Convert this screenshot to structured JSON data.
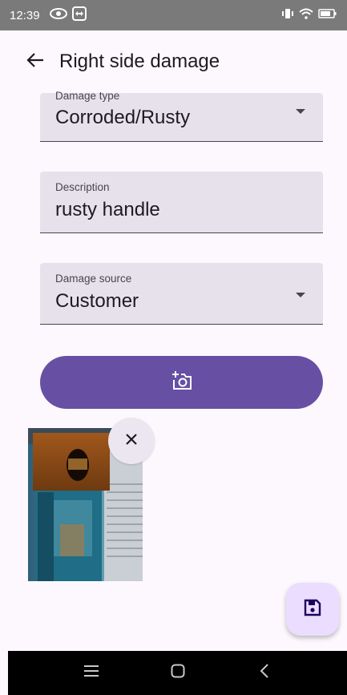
{
  "status_bar": {
    "time": "12:39",
    "left_icons": [
      "eye-icon",
      "teamviewer-icon"
    ],
    "right_icons": [
      "vibrate-icon",
      "wifi-icon",
      "battery-icon"
    ]
  },
  "app_bar": {
    "title": "Right side damage",
    "back_icon": "arrow-back-icon"
  },
  "form": {
    "damage_type": {
      "label": "Damage type",
      "value": "Corroded/Rusty"
    },
    "description": {
      "label": "Description",
      "value": "rusty handle"
    },
    "damage_source": {
      "label": "Damage source",
      "value": "Customer"
    }
  },
  "photo_button": {
    "icon": "add-a-photo-icon"
  },
  "photo": {
    "remove_icon": "close-icon"
  },
  "fab": {
    "icon": "save-icon"
  },
  "nav_bar": {
    "buttons": [
      "menu-icon",
      "home-icon",
      "back-icon"
    ]
  },
  "colors": {
    "accent": "#6750a4",
    "field_bg": "#e7e1ec",
    "fab_bg": "#eaddff",
    "background": "#fdf8fd"
  }
}
